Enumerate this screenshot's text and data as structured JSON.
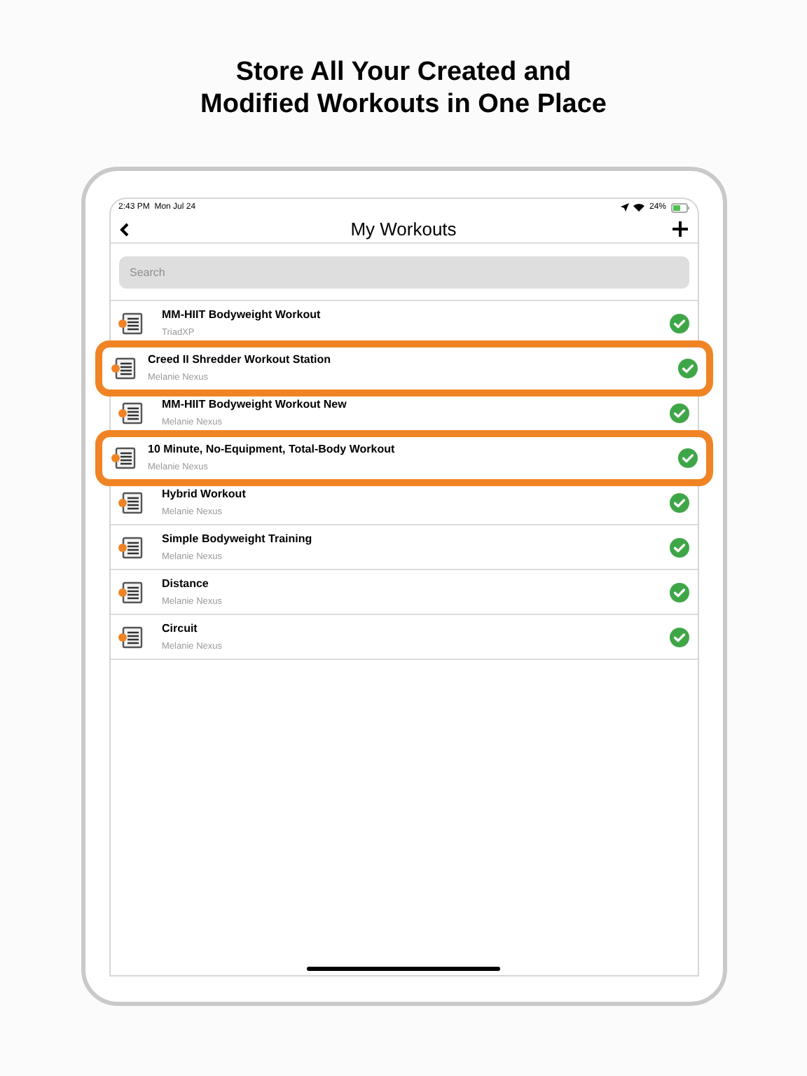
{
  "headline": [
    "Store All Your Created and",
    "Modified Workouts in One Place"
  ],
  "status_bar": {
    "time": "2:43 PM",
    "date": "Mon Jul 24",
    "battery": "24%"
  },
  "nav": {
    "title": "My Workouts"
  },
  "search": {
    "placeholder": "Search"
  },
  "workouts": [
    {
      "title": "MM-HIIT Bodyweight Workout",
      "author": "TriadXP",
      "highlighted": false,
      "done": true
    },
    {
      "title": "Creed II Shredder Workout Station",
      "author": "Melanie Nexus",
      "highlighted": true,
      "done": true
    },
    {
      "title": "MM-HIIT Bodyweight Workout New",
      "author": "Melanie Nexus",
      "highlighted": false,
      "done": true
    },
    {
      "title": "10 Minute, No-Equipment, Total-Body Workout",
      "author": "Melanie Nexus",
      "highlighted": true,
      "done": true
    },
    {
      "title": "Hybrid Workout",
      "author": "Melanie Nexus",
      "highlighted": false,
      "done": true
    },
    {
      "title": "Simple Bodyweight Training",
      "author": "Melanie Nexus",
      "highlighted": false,
      "done": true
    },
    {
      "title": "Distance",
      "author": "Melanie Nexus",
      "highlighted": false,
      "done": true
    },
    {
      "title": "Circuit",
      "author": "Melanie Nexus",
      "highlighted": false,
      "done": true
    }
  ]
}
